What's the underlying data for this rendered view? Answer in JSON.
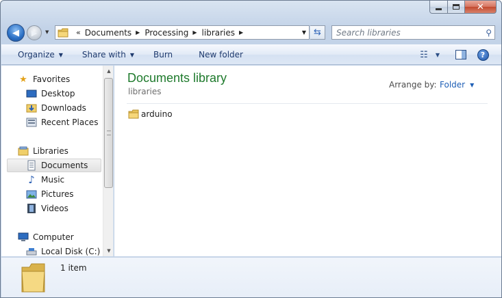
{
  "window": {
    "caption": {
      "minimize": "",
      "maximize": "",
      "close": "✕"
    }
  },
  "nav": {
    "back_glyph": "◀",
    "forward_glyph": "▶"
  },
  "address": {
    "overflow": "«",
    "crumbs": [
      "Documents",
      "Processing",
      "libraries"
    ],
    "separator": "▶"
  },
  "search": {
    "placeholder": "Search libraries"
  },
  "toolbar": {
    "organize": "Organize",
    "share_with": "Share with",
    "burn": "Burn",
    "new_folder": "New folder",
    "help": "?"
  },
  "navpane": {
    "items": [
      {
        "label": "Favorites",
        "icon": "star-icon"
      },
      {
        "label": "Desktop",
        "icon": "desktop-icon"
      },
      {
        "label": "Downloads",
        "icon": "downloads-folder-icon"
      },
      {
        "label": "Recent Places",
        "icon": "recent-places-icon"
      },
      {
        "label": "Libraries",
        "icon": "libraries-icon"
      },
      {
        "label": "Documents",
        "icon": "documents-icon",
        "selected": true
      },
      {
        "label": "Music",
        "icon": "music-icon"
      },
      {
        "label": "Pictures",
        "icon": "pictures-icon"
      },
      {
        "label": "Videos",
        "icon": "videos-icon"
      },
      {
        "label": "Computer",
        "icon": "computer-icon"
      },
      {
        "label": "Local Disk (C:)",
        "icon": "local-disk-icon"
      }
    ]
  },
  "content": {
    "title": "Documents library",
    "subtitle": "libraries",
    "arrange_label": "Arrange by:",
    "arrange_value": "Folder",
    "files": [
      {
        "name": "arduino",
        "icon": "folder-icon"
      }
    ]
  },
  "details": {
    "count": "1 item"
  },
  "colors": {
    "title_green": "#1e7a2c",
    "link_blue": "#1e5fb6",
    "toolbar_text": "#1e3a6e"
  }
}
